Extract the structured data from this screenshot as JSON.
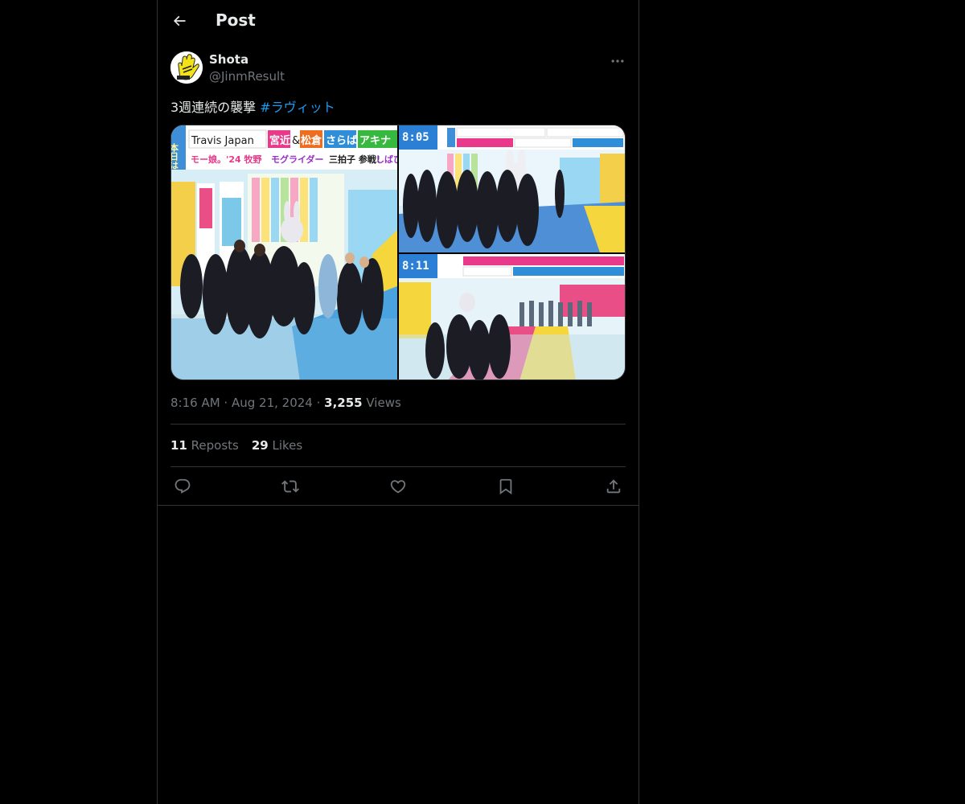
{
  "header": {
    "title": "Post"
  },
  "author": {
    "display_name": "Shota",
    "handle": "@JinmResult"
  },
  "tweet": {
    "text_before": "3週連続の襲撃 ",
    "hashtag": "#ラヴィット"
  },
  "media": {
    "image1": {
      "banner_line1_a": "Travis Japan",
      "banner_line1_b": "宮近",
      "banner_line1_c": "&",
      "banner_line1_d": "松倉",
      "banner_line1_e": "さらば",
      "banner_line1_f": "アキナ",
      "banner_line2_a": "モー娘。'24 牧野",
      "banner_line2_b": "モグライダー",
      "banner_line2_c": "三拍子 参戦!",
      "banner_line2_d": "しばひ",
      "side_label": "本日は"
    },
    "image2": {
      "clock": "8:05"
    },
    "image3": {
      "clock": "8:11"
    }
  },
  "meta": {
    "time": "8:16 AM",
    "sep1": " · ",
    "date": "Aug 21, 2024",
    "sep2": " · ",
    "views_count": "3,255",
    "views_label": " Views"
  },
  "stats": {
    "reposts_count": "11",
    "reposts_label": " Reposts",
    "likes_count": "29",
    "likes_label": " Likes"
  },
  "colors": {
    "background": "#000000",
    "text": "#e7e9ea",
    "muted": "#71767b",
    "accent": "#1d9bf0",
    "border": "#2f3336"
  },
  "icons": {
    "back": "arrow-left-icon",
    "more": "more-horizontal-icon",
    "reply": "reply-icon",
    "repost": "repost-icon",
    "like": "heart-icon",
    "bookmark": "bookmark-icon",
    "share": "share-icon"
  }
}
